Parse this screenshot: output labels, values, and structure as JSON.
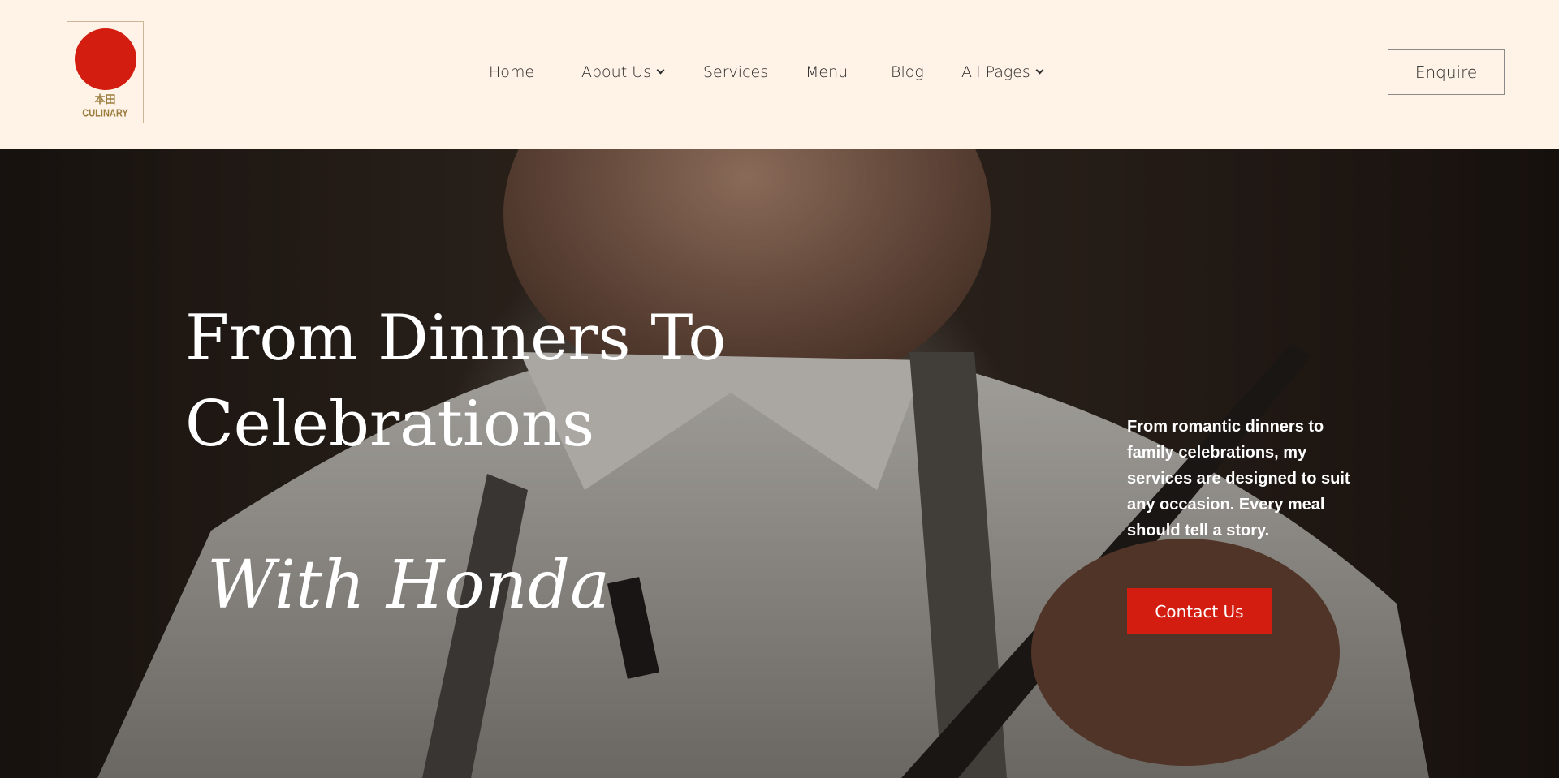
{
  "brand": {
    "kanji": "本田",
    "word": "CULINARY",
    "accent_color": "#d31d10",
    "gold_color": "#9a7d3f"
  },
  "nav": {
    "items": [
      {
        "label": "Home",
        "has_dropdown": false
      },
      {
        "label": "About Us",
        "has_dropdown": true
      },
      {
        "label": "Services",
        "has_dropdown": false
      },
      {
        "label": "Menu",
        "has_dropdown": false
      },
      {
        "label": "Blog",
        "has_dropdown": false
      },
      {
        "label": "All Pages",
        "has_dropdown": true
      }
    ],
    "enquire_label": "Enquire"
  },
  "hero": {
    "title": "From Dinners To Celebrations",
    "subtitle": "With Honda",
    "description": "From romantic dinners to family celebrations, my services are designed to suit any occasion. Every meal should tell a story.",
    "cta_label": "Contact Us",
    "background_image": "chef-holding-knife-photo"
  },
  "colors": {
    "header_bg": "#fff2e6",
    "cta_bg": "#d31d10",
    "text_dark": "#2a2a2a"
  }
}
